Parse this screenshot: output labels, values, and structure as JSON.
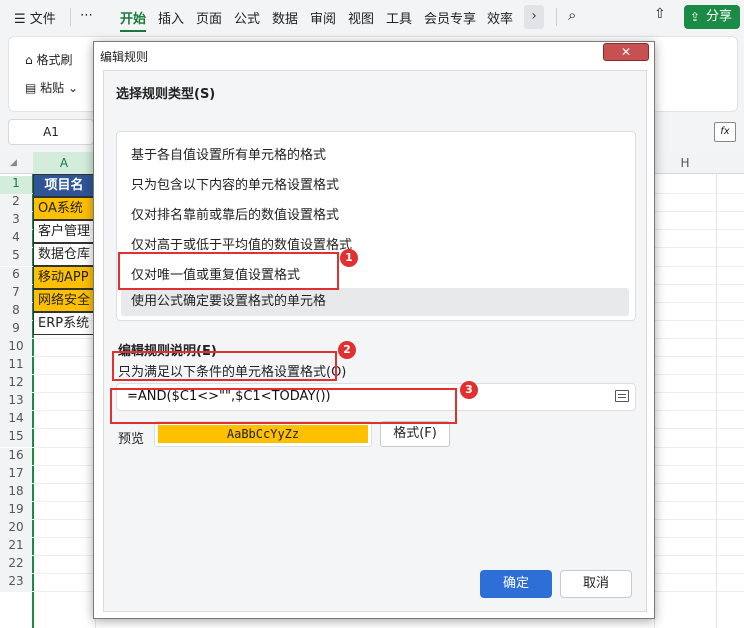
{
  "menubar": {
    "file_label": "文件",
    "more_label": "⋯",
    "tabs": [
      "开始",
      "插入",
      "页面",
      "公式",
      "数据",
      "审阅",
      "视图",
      "工具",
      "会员专享",
      "效率"
    ],
    "share_label": "分享"
  },
  "ribbon": {
    "format_painter": "格式刷",
    "paste": "粘贴"
  },
  "namebox": {
    "value": "A1"
  },
  "sheet": {
    "columns": [
      "A",
      "H"
    ],
    "rows": [
      "1",
      "2",
      "3",
      "4",
      "5",
      "6",
      "7",
      "8",
      "9",
      "10",
      "11",
      "12",
      "13",
      "14",
      "15",
      "16",
      "17",
      "18",
      "19",
      "20",
      "21",
      "22",
      "23"
    ],
    "cells": [
      "项目名",
      "OA系统",
      "客户管理",
      "数据仓库",
      "移动APP",
      "网络安全",
      "ERP系统"
    ]
  },
  "dialog": {
    "title": "编辑规则",
    "close_label": "✕",
    "select_type_label": "选择规则类型(S)",
    "rule_types": [
      "基于各自值设置所有单元格的格式",
      "只为包含以下内容的单元格设置格式",
      "仅对排名靠前或靠后的数值设置格式",
      "仅对高于或低于平均值的数值设置格式",
      "仅对唯一值或重复值设置格式",
      "使用公式确定要设置格式的单元格"
    ],
    "edit_desc_label": "编辑规则说明(E)",
    "formula_prompt": "只为满足以下条件的单元格设置格式(O)",
    "formula_value": "=AND($C1<>\"\",$C1<TODAY())",
    "preview_label": "预览",
    "preview_sample": "AaBbCcYyZz",
    "format_button": "格式(F)",
    "ok_button": "确定",
    "cancel_button": "取消"
  },
  "annotations": [
    "1",
    "2",
    "3"
  ],
  "colors": {
    "accent_green": "#1a8a45",
    "highlight_yellow": "#ffc000",
    "header_blue": "#2f5597",
    "annotation_red": "#e03030",
    "ok_blue": "#2d6fd6"
  }
}
